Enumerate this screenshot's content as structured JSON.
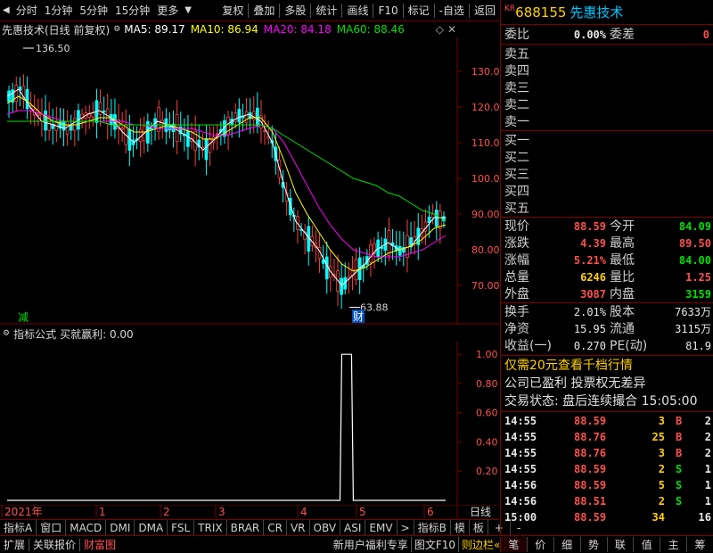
{
  "toolbar": {
    "items": [
      "分时",
      "1分钟",
      "5分钟",
      "15分钟",
      "更多",
      "复权",
      "叠加",
      "多股",
      "统计",
      "画线",
      "F10",
      "标记",
      "-自选",
      "返回"
    ]
  },
  "chart_header": {
    "title": "先惠技术(日线 前复权)",
    "ma5": "MA5: 89.17",
    "ma10": "MA10: 86.94",
    "ma20": "MA20: 84.18",
    "ma60": "MA60: 88.46"
  },
  "chart_data": [
    {
      "type": "candlestick",
      "title": "先惠技术(日线 前复权)",
      "y_ticks": [
        "130.0",
        "120.0",
        "110.0",
        "100.0",
        "90.00",
        "80.00",
        "70.00"
      ],
      "ylim": [
        64,
        138
      ],
      "x_ticks": [
        "2021年",
        "1",
        "2",
        "3",
        "4",
        "5",
        "6"
      ],
      "high_label": "136.50",
      "low_label": "63.88",
      "annotations": [
        "减",
        "财"
      ],
      "series": [
        {
          "name": "MA5",
          "color": "#ffffff",
          "values": [
            123,
            125,
            120,
            116,
            115,
            114,
            116,
            118,
            119,
            117,
            113,
            110,
            113,
            116,
            115,
            113,
            111,
            108,
            111,
            115,
            117,
            118,
            116,
            110,
            98,
            88,
            84,
            80,
            74,
            70,
            73,
            76,
            80,
            82,
            80,
            81,
            85,
            89,
            89
          ]
        },
        {
          "name": "MA10",
          "color": "#ffff00",
          "values": [
            121,
            123,
            121,
            118,
            116,
            115,
            115,
            116,
            117,
            117,
            115,
            113,
            113,
            114,
            115,
            114,
            113,
            111,
            111,
            113,
            115,
            117,
            117,
            113,
            105,
            96,
            90,
            85,
            80,
            76,
            74,
            75,
            77,
            79,
            80,
            81,
            83,
            86,
            87
          ]
        },
        {
          "name": "MA20",
          "color": "#ff00ff",
          "values": [
            118,
            119,
            119,
            118,
            117,
            116,
            116,
            116,
            116,
            116,
            116,
            115,
            115,
            114,
            114,
            114,
            114,
            113,
            112,
            112,
            113,
            114,
            115,
            114,
            110,
            104,
            98,
            92,
            87,
            83,
            80,
            79,
            78,
            78,
            78,
            79,
            80,
            82,
            84
          ]
        },
        {
          "name": "MA60",
          "color": "#00e000",
          "values": [
            116,
            116,
            116,
            116,
            116,
            116,
            116,
            116,
            116,
            115,
            115,
            115,
            115,
            115,
            115,
            115,
            115,
            115,
            115,
            115,
            115,
            115,
            115,
            114,
            112,
            110,
            108,
            106,
            104,
            102,
            100,
            99,
            98,
            96,
            95,
            93,
            91,
            90,
            88
          ]
        }
      ]
    },
    {
      "type": "line",
      "title": "指标公式 买就赢利: 0.00",
      "y_ticks": [
        "1.00",
        "0.80",
        "0.60",
        "0.40",
        "0.20"
      ],
      "ylim": [
        0,
        1.05
      ],
      "series": [
        {
          "name": "买就赢利",
          "values": [
            0,
            0,
            0,
            0,
            0,
            0,
            0,
            0,
            0,
            0,
            0,
            0,
            0,
            0,
            0,
            0,
            0,
            0,
            0,
            0,
            0,
            0,
            0,
            0,
            0,
            0,
            0,
            0,
            0,
            1,
            0,
            0,
            0,
            0,
            0,
            0,
            0,
            0,
            0
          ]
        }
      ]
    }
  ],
  "sub_header": {
    "label": "指标公式",
    "value": "买就赢利: 0.00"
  },
  "indicator_tabs": [
    "指标A",
    "窗口",
    "MACD",
    "DMI",
    "DMA",
    "FSL",
    "TRIX",
    "BRAR",
    "CR",
    "VR",
    "OBV",
    "ASI",
    "EMV",
    ">",
    "指标B",
    "模",
    "板",
    "+",
    "-"
  ],
  "period_label": "日线",
  "status_bar": {
    "left": [
      "扩展",
      "关联报价",
      "财富图"
    ],
    "middle": [
      "新用户福利专享",
      "图文F10",
      "则边栏«"
    ],
    "right": [
      "笔",
      "价",
      "细",
      "势",
      "联",
      "值",
      "主",
      "筹"
    ]
  },
  "stock": {
    "badge": "KR",
    "code": "688155",
    "name": "先惠技术"
  },
  "order_book": {
    "weibi_label": "委比",
    "weibi_value": "0.00%",
    "weicha_label": "委差",
    "weicha_value": "0",
    "asks": [
      "卖五",
      "卖四",
      "卖三",
      "卖二",
      "卖一"
    ],
    "bids": [
      "买一",
      "买二",
      "买三",
      "买四",
      "买五"
    ]
  },
  "quotes": [
    {
      "l1": "现价",
      "v1": "88.59",
      "c1": "red",
      "l2": "今开",
      "v2": "84.09",
      "c2": "green"
    },
    {
      "l1": "涨跌",
      "v1": "4.39",
      "c1": "red",
      "l2": "最高",
      "v2": "89.50",
      "c2": "red"
    },
    {
      "l1": "涨幅",
      "v1": "5.21%",
      "c1": "red",
      "l2": "最低",
      "v2": "84.00",
      "c2": "green"
    },
    {
      "l1": "总量",
      "v1": "6246",
      "c1": "yellow",
      "l2": "量比",
      "v2": "1.25",
      "c2": "red"
    },
    {
      "l1": "外盘",
      "v1": "3087",
      "c1": "red",
      "l2": "内盘",
      "v2": "3159",
      "c2": "green"
    }
  ],
  "fundamentals": [
    {
      "l1": "换手",
      "v1": "2.01%",
      "l2": "股本",
      "v2": "7633万"
    },
    {
      "l1": "净资",
      "v1": "15.95",
      "l2": "流通",
      "v2": "3115万"
    },
    {
      "l1": "收益(一)",
      "v1": "0.270",
      "l2": "PE(动)",
      "v2": "81.9"
    }
  ],
  "promo": "仅需20元查看千档行情",
  "notice": "公司已盈利 投票权无差异",
  "trade_status": "交易状态: 盘后连续撮合 15:05:00",
  "ticks": [
    {
      "time": "14:55",
      "price": "88.59",
      "vol": "3",
      "bs": "B",
      "num": "2",
      "bc": "red"
    },
    {
      "time": "14:55",
      "price": "88.76",
      "vol": "25",
      "bs": "B",
      "num": "2",
      "bc": "red"
    },
    {
      "time": "14:55",
      "price": "88.76",
      "vol": "3",
      "bs": "B",
      "num": "2",
      "bc": "red"
    },
    {
      "time": "14:55",
      "price": "88.59",
      "vol": "2",
      "bs": "S",
      "num": "1",
      "bc": "green"
    },
    {
      "time": "14:56",
      "price": "88.59",
      "vol": "5",
      "bs": "S",
      "num": "1",
      "bc": "green"
    },
    {
      "time": "14:56",
      "price": "88.51",
      "vol": "2",
      "bs": "S",
      "num": "1",
      "bc": "green"
    },
    {
      "time": "15:00",
      "price": "88.59",
      "vol": "34",
      "bs": "",
      "num": "16",
      "bc": "white"
    }
  ],
  "colors": {
    "up": "#ff4040",
    "down": "#00ffff",
    "border": "#7a0000"
  }
}
